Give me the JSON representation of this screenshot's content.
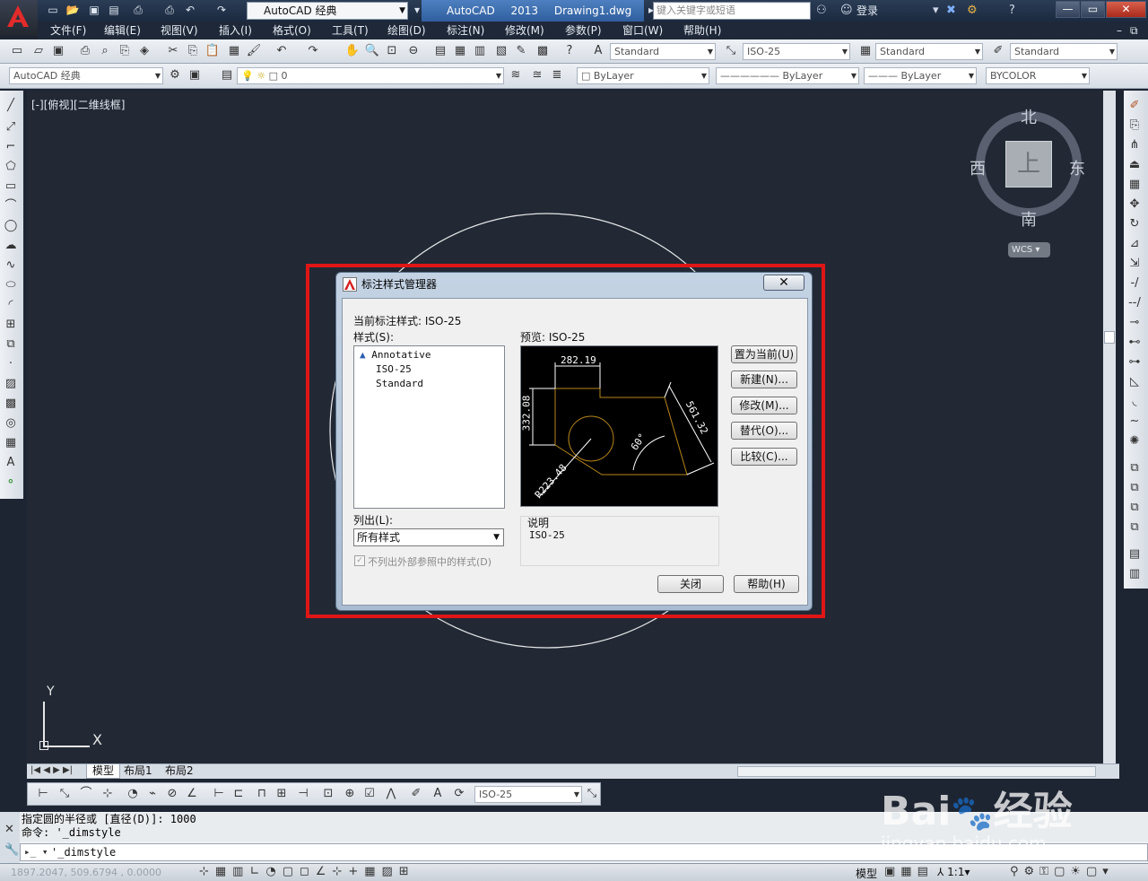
{
  "app": {
    "title": "AutoCAD 2013",
    "filename": "Drawing1.dwg",
    "workspace": "AutoCAD 经典",
    "search_placeholder": "键入关键字或短语",
    "login": "登录"
  },
  "menus": [
    "文件(F)",
    "编辑(E)",
    "视图(V)",
    "插入(I)",
    "格式(O)",
    "工具(T)",
    "绘图(D)",
    "标注(N)",
    "修改(M)",
    "参数(P)",
    "窗口(W)",
    "帮助(H)"
  ],
  "styles_toolbar": {
    "text_style": "Standard",
    "dim_style": "ISO-25",
    "table_style": "Standard",
    "multileader_style": "Standard"
  },
  "layers_toolbar": {
    "workspace": "AutoCAD 经典",
    "layer": "0",
    "color": "ByLayer",
    "linetype": "ByLayer",
    "lineweight": "ByLayer",
    "plotstyle": "BYCOLOR"
  },
  "canvas": {
    "view_label": "[-][俯视][二维线框]"
  },
  "viewcube": {
    "north": "北",
    "south": "南",
    "east": "东",
    "west": "西",
    "top": "上",
    "wcs": "WCS"
  },
  "ucs": {
    "x": "X",
    "y": "Y"
  },
  "tabs": [
    "模型",
    "布局1",
    "布局2"
  ],
  "dim_toolbar": {
    "style": "ISO-25"
  },
  "command": {
    "history": [
      "指定圆的半径或 [直径(D)]: 1000",
      "命令: '_dimstyle"
    ],
    "current": "'_dimstyle"
  },
  "status": {
    "coords": "1897.2047, 509.6794 , 0.0000",
    "model": "模型",
    "scale": "1:1"
  },
  "dialog": {
    "title": "标注样式管理器",
    "current_style_label": "当前标注样式: ISO-25",
    "styles_label": "样式(S):",
    "styles": [
      "Annotative",
      "ISO-25",
      "Standard"
    ],
    "preview_label": "预览: ISO-25",
    "list_label": "列出(L):",
    "list_value": "所有样式",
    "checkbox_label": "不列出外部参照中的样式(D)",
    "desc_label": "说明",
    "desc_value": "ISO-25",
    "buttons": {
      "set_current": "置为当前(U)",
      "new": "新建(N)...",
      "modify": "修改(M)...",
      "override": "替代(O)...",
      "compare": "比较(C)...",
      "close": "关闭",
      "help": "帮助(H)"
    },
    "preview_dims": {
      "top": "282.19",
      "left": "332.08",
      "angled": "561.32",
      "angle": "60°",
      "radius": "R223.48"
    }
  },
  "watermark": {
    "brand": "Bai",
    "brand2": "经验",
    "url": "jingyan.baidu.com"
  }
}
